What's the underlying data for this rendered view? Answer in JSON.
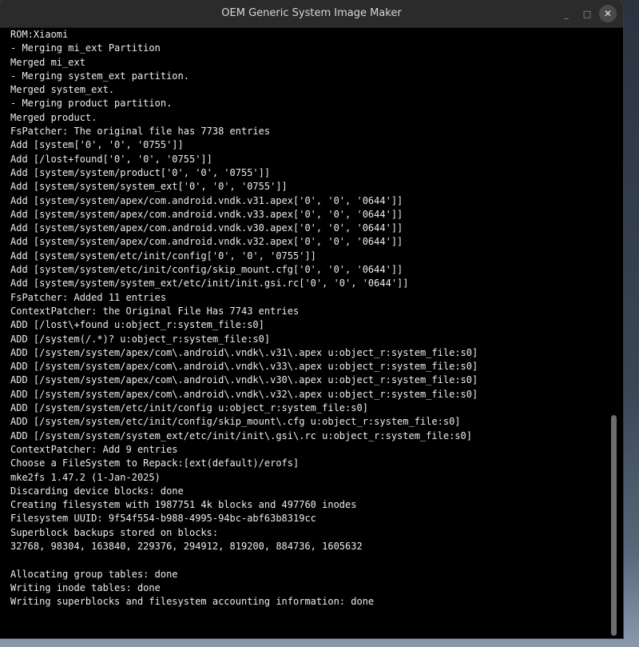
{
  "window": {
    "title": "OEM Generic System Image Maker",
    "controls": {
      "minimize": "_",
      "maximize": "□",
      "close": "✕"
    }
  },
  "terminal": {
    "lines": [
      "ROM:Xiaomi",
      "- Merging mi_ext Partition",
      "Merged mi_ext",
      "- Merging system_ext partition.",
      "Merged system_ext.",
      "- Merging product partition.",
      "Merged product.",
      "FsPatcher: The original file has 7738 entries",
      "Add [system['0', '0', '0755']]",
      "Add [/lost+found['0', '0', '0755']]",
      "Add [system/system/product['0', '0', '0755']]",
      "Add [system/system/system_ext['0', '0', '0755']]",
      "Add [system/system/apex/com.android.vndk.v31.apex['0', '0', '0644']]",
      "Add [system/system/apex/com.android.vndk.v33.apex['0', '0', '0644']]",
      "Add [system/system/apex/com.android.vndk.v30.apex['0', '0', '0644']]",
      "Add [system/system/apex/com.android.vndk.v32.apex['0', '0', '0644']]",
      "Add [system/system/etc/init/config['0', '0', '0755']]",
      "Add [system/system/etc/init/config/skip_mount.cfg['0', '0', '0644']]",
      "Add [system/system/system_ext/etc/init/init.gsi.rc['0', '0', '0644']]",
      "FsPatcher: Added 11 entries",
      "ContextPatcher: the Original File Has 7743 entries",
      "ADD [/lost\\+found u:object_r:system_file:s0]",
      "ADD [/system(/.*)? u:object_r:system_file:s0]",
      "ADD [/system/system/apex/com\\.android\\.vndk\\.v31\\.apex u:object_r:system_file:s0]",
      "ADD [/system/system/apex/com\\.android\\.vndk\\.v33\\.apex u:object_r:system_file:s0]",
      "ADD [/system/system/apex/com\\.android\\.vndk\\.v30\\.apex u:object_r:system_file:s0]",
      "ADD [/system/system/apex/com\\.android\\.vndk\\.v32\\.apex u:object_r:system_file:s0]",
      "ADD [/system/system/etc/init/config u:object_r:system_file:s0]",
      "ADD [/system/system/etc/init/config/skip_mount\\.cfg u:object_r:system_file:s0]",
      "ADD [/system/system/system_ext/etc/init/init\\.gsi\\.rc u:object_r:system_file:s0]",
      "ContextPatcher: Add 9 entries",
      "Choose a FileSystem to Repack:[ext(default)/erofs]",
      "mke2fs 1.47.2 (1-Jan-2025)",
      "Discarding device blocks: done",
      "Creating filesystem with 1987751 4k blocks and 497760 inodes",
      "Filesystem UUID: 9f54f554-b988-4995-94bc-abf63b8319cc",
      "Superblock backups stored on blocks:",
      "32768, 98304, 163840, 229376, 294912, 819200, 884736, 1605632",
      "",
      "Allocating group tables: done",
      "Writing inode tables: done",
      "Writing superblocks and filesystem accounting information: done",
      "",
      ""
    ]
  }
}
